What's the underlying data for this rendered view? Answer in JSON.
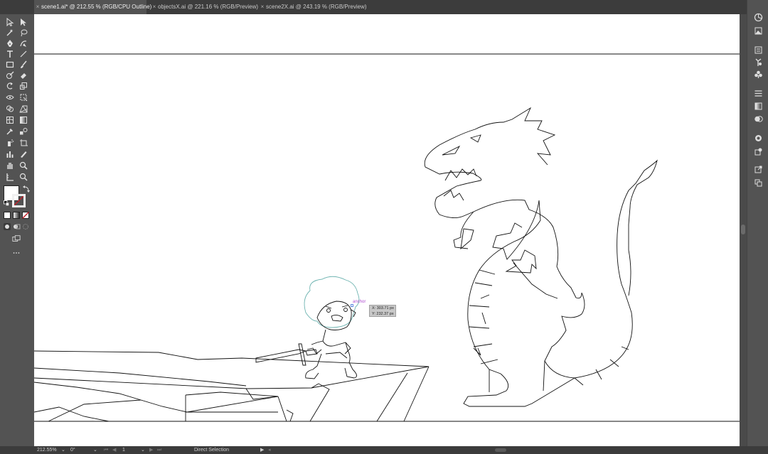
{
  "tabs": [
    {
      "label": "scene1.ai* @ 212.55 % (RGB/CPU Outline)",
      "active": true
    },
    {
      "label": "objectsX.ai @ 221.16 % (RGB/Preview)",
      "active": false
    },
    {
      "label": "scene2X.ai @ 243.19 % (RGB/Preview)",
      "active": false
    }
  ],
  "close_glyph": "×",
  "canvas": {
    "anchor_label": "anchor",
    "coord_x": "X: 303.71 px",
    "coord_y": "Y: 232.37 px"
  },
  "status": {
    "zoom": "212.55%",
    "rotation": "0°",
    "artboard": "1",
    "tool": "Direct Selection"
  },
  "tools": [
    "selection-icon",
    "direct-selection-icon",
    "magic-wand-icon",
    "lasso-icon",
    "pen-icon",
    "curvature-icon",
    "type-icon",
    "line-segment-icon",
    "rectangle-icon",
    "paintbrush-icon",
    "shaper-icon",
    "eraser-icon",
    "rotate-icon",
    "scale-icon",
    "width-icon",
    "free-transform-icon",
    "shape-builder-icon",
    "perspective-grid-icon",
    "mesh-icon",
    "gradient-icon",
    "eyedropper-icon",
    "blend-icon",
    "symbol-sprayer-icon",
    "artboard-icon",
    "column-graph-icon",
    "slice-icon",
    "hand-icon",
    "zoom-icon"
  ],
  "panel_icons": [
    "color-guide-icon",
    "libraries-icon",
    "properties-icon",
    "symbols-icon",
    "brushes-icon",
    "align-icon",
    "gradient-panel-icon",
    "transparency-icon",
    "appearance-icon",
    "graphic-styles-icon",
    "export-icon",
    "layers-icon"
  ],
  "colors": {
    "ui_background": "#535353",
    "tabbar": "#3c3c3c",
    "artboard": "#ffffff",
    "anchor_label": "#b04fd0"
  }
}
